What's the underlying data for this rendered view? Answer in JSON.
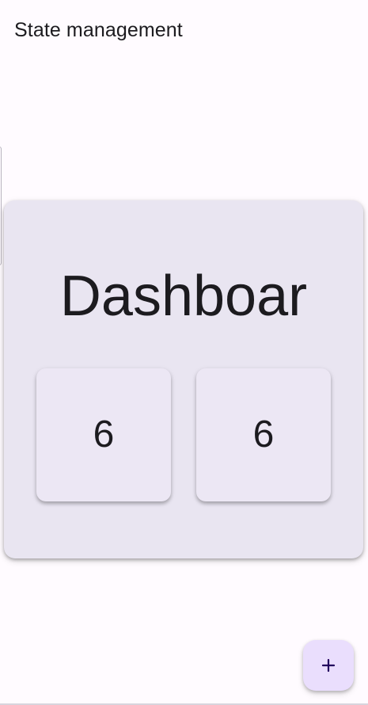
{
  "app_bar": {
    "title": "State management"
  },
  "dashboard": {
    "title": "Dashboar",
    "counters": [
      {
        "value": "6"
      },
      {
        "value": "6"
      }
    ]
  },
  "fab": {
    "icon": "plus-icon",
    "accent": "#eadefd"
  },
  "colors": {
    "background": "#fffbff",
    "card": "#e9e5f1",
    "tile": "#ece7f4",
    "text": "#1c1b1f"
  }
}
